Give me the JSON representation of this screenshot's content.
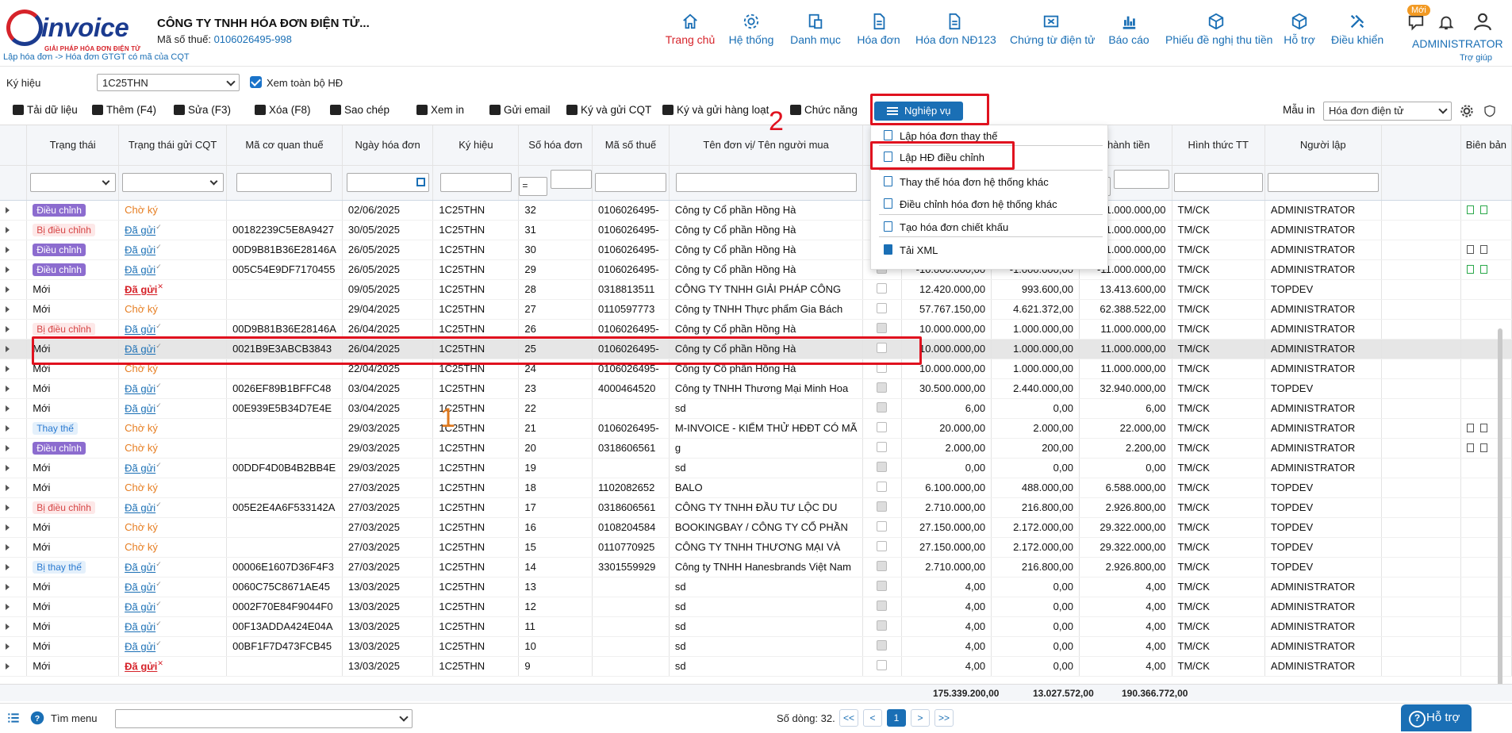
{
  "header": {
    "brand": "invoice",
    "tagline": "GIẢI PHÁP HÓA ĐƠN ĐIỆN TỬ",
    "company": "CÔNG TY TNHH HÓA ĐƠN ĐIỆN TỬ...",
    "tax_label": "Mã số thuế:",
    "tax_value": "0106026495-998",
    "breadcrumb": "Lập hóa đơn -> Hóa đơn GTGT có mã của CQT",
    "nav": [
      {
        "label": "Trang chủ",
        "icon": "home-icon"
      },
      {
        "label": "Hệ thống",
        "icon": "gear-icon"
      },
      {
        "label": "Danh mục",
        "icon": "folder-icon"
      },
      {
        "label": "Hóa đơn",
        "icon": "document-icon"
      },
      {
        "label": "Hóa đơn NĐ123",
        "icon": "document-icon"
      },
      {
        "label": "Chứng từ điện tử",
        "icon": "ticket-icon"
      },
      {
        "label": "Báo cáo",
        "icon": "bar-chart-icon"
      },
      {
        "label": "Phiếu đề nghị thu tiền",
        "icon": "cube-icon"
      },
      {
        "label": "Hỗ trợ",
        "icon": "cube-icon"
      },
      {
        "label": "Điều khiển",
        "icon": "tools-icon"
      }
    ],
    "new_badge": "Mới",
    "user": "ADMINISTRATOR",
    "help": "Trợ giúp"
  },
  "filters": {
    "ky_hieu_label": "Ký hiệu",
    "ky_hieu_value": "1C25THN",
    "view_all_label": "Xem toàn bộ HĐ"
  },
  "toolbar": {
    "items": [
      "Tải dữ liệu",
      "Thêm (F4)",
      "Sửa (F3)",
      "Xóa (F8)",
      "Sao chép",
      "Xem in",
      "Gửi email",
      "Ký và gửi CQT",
      "Ký và gửi hàng loạt",
      "Chức năng"
    ],
    "nghiep_vu": "Nghiệp vụ",
    "mau_in_label": "Mẫu in",
    "mau_in_value": "Hóa đơn điện tử"
  },
  "dropdown": {
    "items": [
      "Lập hóa đơn thay thế",
      "Lập HĐ điều chỉnh",
      "Thay thế hóa đơn hệ thống khác",
      "Điều chỉnh hóa đơn hệ thống khác",
      "Tạo hóa đơn chiết khấu",
      "Tải XML"
    ]
  },
  "annotations": {
    "one": "1",
    "two": "2"
  },
  "table": {
    "columns": [
      "Trạng thái",
      "Trạng thái gửi CQT",
      "Mã cơ quan thuế",
      "Ngày hóa đơn",
      "Ký hiệu",
      "Số hóa đơn",
      "Mã số thuế",
      "Tên đơn vị/ Tên người mua",
      "",
      "",
      "",
      "Thành tiền",
      "Hình thức TT",
      "Người lập",
      "Biên bản"
    ],
    "num_filter_op": "=",
    "rows": [
      [
        "Điều chỉnh",
        "Chờ ký",
        "",
        "02/06/2025",
        "1C25THN",
        "32",
        "0106026495-",
        "Công ty Cổ phần Hồng Hà",
        "",
        "",
        "",
        "-1.000.000,00",
        "TM/CK",
        "ADMINISTRATOR"
      ],
      [
        "Bị điều chỉnh",
        "Đã gửi",
        "00182239C5E8A9427",
        "30/05/2025",
        "1C25THN",
        "31",
        "0106026495-",
        "Công ty Cổ phần Hồng Hà",
        "",
        "",
        "",
        "-11.000.000,00",
        "TM/CK",
        "ADMINISTRATOR"
      ],
      [
        "Điều chỉnh",
        "Đã gửi",
        "00D9B81B36E28146A",
        "26/05/2025",
        "1C25THN",
        "30",
        "0106026495-",
        "Công ty Cổ phần Hồng Hà",
        "",
        "",
        "",
        "-11.000.000,00",
        "TM/CK",
        "ADMINISTRATOR"
      ],
      [
        "Điều chỉnh",
        "Đã gửi",
        "005C54E9DF7170455",
        "26/05/2025",
        "1C25THN",
        "29",
        "0106026495-",
        "Công ty Cổ phần Hồng Hà",
        "",
        "-10.000.000,00",
        "-1.000.000,00",
        "-11.000.000,00",
        "TM/CK",
        "ADMINISTRATOR"
      ],
      [
        "Mới",
        "Đã gửi",
        "",
        "09/05/2025",
        "1C25THN",
        "28",
        "0318813511",
        "CÔNG TY TNHH GIẢI PHÁP CÔNG",
        "",
        "12.420.000,00",
        "993.600,00",
        "13.413.600,00",
        "TM/CK",
        "TOPDEV"
      ],
      [
        "Mới",
        "Chờ ký",
        "",
        "29/04/2025",
        "1C25THN",
        "27",
        "0110597773",
        "Công ty TNHH Thực phẩm Gia Bách",
        "",
        "57.767.150,00",
        "4.621.372,00",
        "62.388.522,00",
        "TM/CK",
        "ADMINISTRATOR"
      ],
      [
        "Bị điều chỉnh",
        "Đã gửi",
        "00D9B81B36E28146A",
        "26/04/2025",
        "1C25THN",
        "26",
        "0106026495-",
        "Công ty Cổ phần Hồng Hà",
        "",
        "10.000.000,00",
        "1.000.000,00",
        "11.000.000,00",
        "TM/CK",
        "ADMINISTRATOR"
      ],
      [
        "Mới",
        "Đã gửi",
        "0021B9E3ABCB3843",
        "26/04/2025",
        "1C25THN",
        "25",
        "0106026495-",
        "Công ty Cổ phần Hồng Hà",
        "",
        "10.000.000,00",
        "1.000.000,00",
        "11.000.000,00",
        "TM/CK",
        "ADMINISTRATOR"
      ],
      [
        "Mới",
        "Chờ ký",
        "",
        "22/04/2025",
        "1C25THN",
        "24",
        "0106026495-",
        "Công ty Cổ phần Hồng Hà",
        "",
        "10.000.000,00",
        "1.000.000,00",
        "11.000.000,00",
        "TM/CK",
        "ADMINISTRATOR"
      ],
      [
        "Mới",
        "Đã gửi",
        "0026EF89B1BFFC48",
        "03/04/2025",
        "1C25THN",
        "23",
        "4000464520",
        "Công ty TNHH Thương Mại Minh Hoa",
        "",
        "30.500.000,00",
        "2.440.000,00",
        "32.940.000,00",
        "TM/CK",
        "TOPDEV"
      ],
      [
        "Mới",
        "Đã gửi",
        "00E939E5B34D7E4E",
        "03/04/2025",
        "1C25THN",
        "22",
        "",
        "sd",
        "",
        "6,00",
        "0,00",
        "6,00",
        "TM/CK",
        "ADMINISTRATOR"
      ],
      [
        "Thay thế",
        "Chờ ký",
        "",
        "29/03/2025",
        "1C25THN",
        "21",
        "0106026495-",
        "M-INVOICE - KIỂM THỬ HĐĐT CÓ MÃ",
        "",
        "20.000,00",
        "2.000,00",
        "22.000,00",
        "TM/CK",
        "ADMINISTRATOR"
      ],
      [
        "Điều chỉnh",
        "Chờ ký",
        "",
        "29/03/2025",
        "1C25THN",
        "20",
        "0318606561",
        "g",
        "",
        "2.000,00",
        "200,00",
        "2.200,00",
        "TM/CK",
        "ADMINISTRATOR"
      ],
      [
        "Mới",
        "Đã gửi",
        "00DDF4D0B4B2BB4E",
        "29/03/2025",
        "1C25THN",
        "19",
        "",
        "sd",
        "",
        "0,00",
        "0,00",
        "0,00",
        "TM/CK",
        "ADMINISTRATOR"
      ],
      [
        "Mới",
        "Chờ ký",
        "",
        "27/03/2025",
        "1C25THN",
        "18",
        "1102082652",
        "BALO",
        "",
        "6.100.000,00",
        "488.000,00",
        "6.588.000,00",
        "TM/CK",
        "TOPDEV"
      ],
      [
        "Bị điều chỉnh",
        "Đã gửi",
        "005E2E4A6F533142A",
        "27/03/2025",
        "1C25THN",
        "17",
        "0318606561",
        "CÔNG TY TNHH ĐẦU TƯ LỘC DU",
        "",
        "2.710.000,00",
        "216.800,00",
        "2.926.800,00",
        "TM/CK",
        "TOPDEV"
      ],
      [
        "Mới",
        "Chờ ký",
        "",
        "27/03/2025",
        "1C25THN",
        "16",
        "0108204584",
        "BOOKINGBAY / CÔNG TY CỔ PHẦN",
        "",
        "27.150.000,00",
        "2.172.000,00",
        "29.322.000,00",
        "TM/CK",
        "TOPDEV"
      ],
      [
        "Mới",
        "Chờ ký",
        "",
        "27/03/2025",
        "1C25THN",
        "15",
        "0110770925",
        "CÔNG TY TNHH THƯƠNG MẠI VÀ",
        "",
        "27.150.000,00",
        "2.172.000,00",
        "29.322.000,00",
        "TM/CK",
        "TOPDEV"
      ],
      [
        "Bị thay thế",
        "Đã gửi",
        "00006E1607D36F4F3",
        "27/03/2025",
        "1C25THN",
        "14",
        "3301559929",
        "Công ty TNHH Hanesbrands Việt Nam",
        "",
        "2.710.000,00",
        "216.800,00",
        "2.926.800,00",
        "TM/CK",
        "TOPDEV"
      ],
      [
        "Mới",
        "Đã gửi",
        "0060C75C8671AE45",
        "13/03/2025",
        "1C25THN",
        "13",
        "",
        "sd",
        "",
        "4,00",
        "0,00",
        "4,00",
        "TM/CK",
        "ADMINISTRATOR"
      ],
      [
        "Mới",
        "Đã gửi",
        "0002F70E84F9044F0",
        "13/03/2025",
        "1C25THN",
        "12",
        "",
        "sd",
        "",
        "4,00",
        "0,00",
        "4,00",
        "TM/CK",
        "ADMINISTRATOR"
      ],
      [
        "Mới",
        "Đã gửi",
        "00F13ADDA424E04A",
        "13/03/2025",
        "1C25THN",
        "11",
        "",
        "sd",
        "",
        "4,00",
        "0,00",
        "4,00",
        "TM/CK",
        "ADMINISTRATOR"
      ],
      [
        "Mới",
        "Đã gửi",
        "00BF1F7D473FCB45",
        "13/03/2025",
        "1C25THN",
        "10",
        "",
        "sd",
        "",
        "4,00",
        "0,00",
        "4,00",
        "TM/CK",
        "ADMINISTRATOR"
      ],
      [
        "Mới",
        "Đã gửi",
        "",
        "13/03/2025",
        "1C25THN",
        "9",
        "",
        "sd",
        "",
        "4,00",
        "0,00",
        "4,00",
        "TM/CK",
        "ADMINISTRATOR"
      ]
    ],
    "totals": [
      "175.339.200,00",
      "13.027.572,00",
      "190.366.772,00"
    ]
  },
  "footer": {
    "menu_search": "Tìm menu",
    "row_count": "Số dòng: 32.",
    "first": "<<",
    "prev": "<",
    "page": "1",
    "next": ">",
    "last": ">>",
    "support": "Hỗ trợ"
  },
  "colors": {
    "primary": "#1a6fb5",
    "accent_red": "#d6232a",
    "highlight": "#e0121f"
  }
}
